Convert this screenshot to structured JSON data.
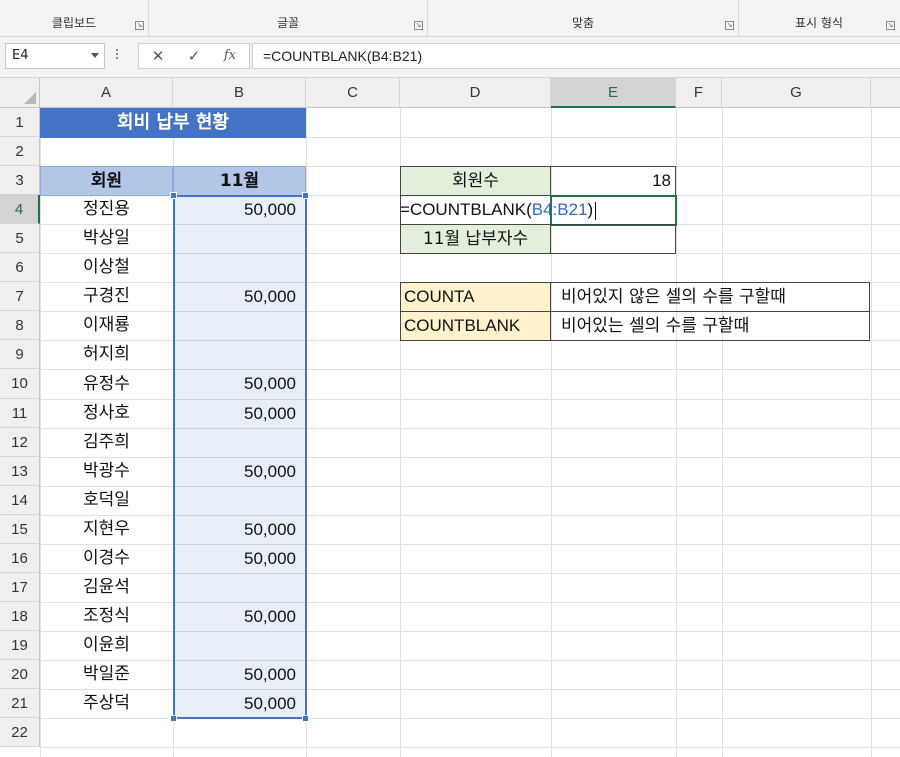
{
  "ribbon": {
    "groups": [
      {
        "label": "클립보드"
      },
      {
        "label": "글꼴"
      },
      {
        "label": "맞춤"
      },
      {
        "label": "표시 형식"
      }
    ]
  },
  "formula_bar": {
    "name_box": "E4",
    "cancel_icon": "✕",
    "enter_icon": "✓",
    "fx_icon": "fx",
    "formula": "=COUNTBLANK(B4:B21)"
  },
  "columns": [
    "A",
    "B",
    "C",
    "D",
    "E",
    "F",
    "G"
  ],
  "rows": [
    "1",
    "2",
    "3",
    "4",
    "5",
    "6",
    "7",
    "8",
    "9",
    "10",
    "11",
    "12",
    "13",
    "14",
    "15",
    "16",
    "17",
    "18",
    "19",
    "20",
    "21",
    "22"
  ],
  "sheet": {
    "title": "회비 납부 현황",
    "header_name": "회원",
    "header_month": "11월",
    "members": [
      {
        "name": "정진용",
        "paid": "50,000"
      },
      {
        "name": "박상일",
        "paid": ""
      },
      {
        "name": "이상철",
        "paid": ""
      },
      {
        "name": "구경진",
        "paid": "50,000"
      },
      {
        "name": "이재룡",
        "paid": ""
      },
      {
        "name": "허지희",
        "paid": ""
      },
      {
        "name": "유정수",
        "paid": "50,000"
      },
      {
        "name": "정사호",
        "paid": "50,000"
      },
      {
        "name": "김주희",
        "paid": ""
      },
      {
        "name": "박광수",
        "paid": "50,000"
      },
      {
        "name": "호덕일",
        "paid": ""
      },
      {
        "name": "지현우",
        "paid": "50,000"
      },
      {
        "name": "이경수",
        "paid": "50,000"
      },
      {
        "name": "김윤석",
        "paid": ""
      },
      {
        "name": "조정식",
        "paid": "50,000"
      },
      {
        "name": "이윤희",
        "paid": ""
      },
      {
        "name": "박일준",
        "paid": "50,000"
      },
      {
        "name": "주상덕",
        "paid": "50,000"
      }
    ],
    "summary": {
      "member_count_label": "회원수",
      "member_count_value": "18",
      "editing_prefix": "=COUNTBLANK(",
      "editing_ref": "B4:B21",
      "editing_suffix": ")",
      "nov_unpaid_label": "11월 납부자수"
    },
    "notes": [
      {
        "func": "COUNTA",
        "desc": "비어있지 않은 셀의 수를 구할때"
      },
      {
        "func": "COUNTBLANK",
        "desc": "비어있는 셀의 수를 구할때"
      }
    ]
  },
  "colors": {
    "title_fill": "#4472c4",
    "header_fill": "#b4c6e7",
    "selection_border": "#4472c4",
    "active_border": "#217346",
    "label_green": "#e2efda",
    "label_yellow": "#fff2cc"
  }
}
